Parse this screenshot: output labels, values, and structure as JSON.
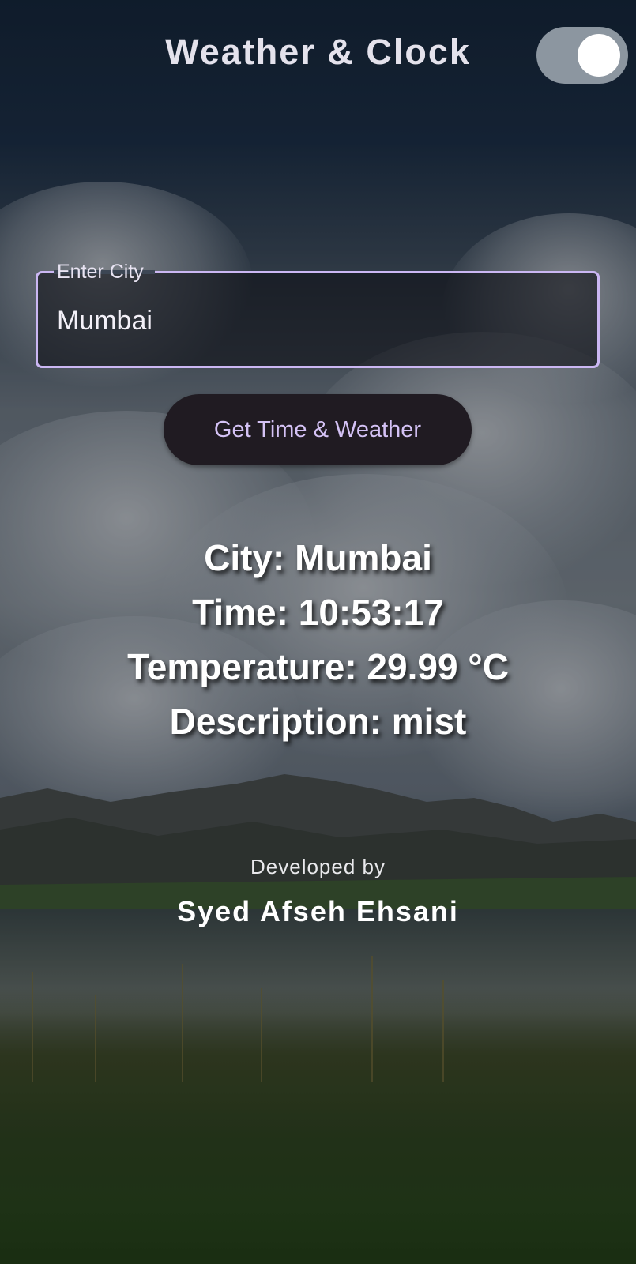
{
  "header": {
    "title": "Weather & Clock",
    "theme_toggle": {
      "state": "on"
    }
  },
  "city_field": {
    "label": "Enter City",
    "value": "Mumbai"
  },
  "actions": {
    "get_button_label": "Get Time & Weather"
  },
  "results": {
    "city": "City: Mumbai",
    "time": "Time: 10:53:17",
    "temperature": "Temperature: 29.99 °C",
    "description": "Description: mist"
  },
  "footer": {
    "developed_by_label": "Developed by",
    "developer_name": "Syed Afseh Ehsani"
  },
  "colors": {
    "accent": "#cbb7f3",
    "button_text": "#d4c2f5",
    "button_bg": "#201b22",
    "toggle_track": "#8c96a0"
  }
}
